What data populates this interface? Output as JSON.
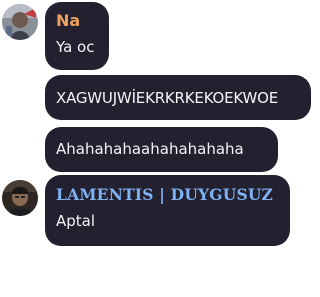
{
  "messages": [
    {
      "author": "Na",
      "author_color": "#f0a15c",
      "avatar": "avatar-photo-icon",
      "text": "Ya oc"
    },
    {
      "text": "XAGWUJWİEKRKRKEKOEKWOE"
    },
    {
      "text": "Ahahahahaahahahahaha"
    },
    {
      "author": "LAMENTIS | DUYGUSUZ",
      "author_color": "#7fb2f3",
      "avatar": "avatar-photo-icon",
      "text": "Aptal"
    }
  ],
  "colors": {
    "bubble_background": "#23202f",
    "message_text": "#f4f4f6",
    "page_background": "#ffffff"
  }
}
